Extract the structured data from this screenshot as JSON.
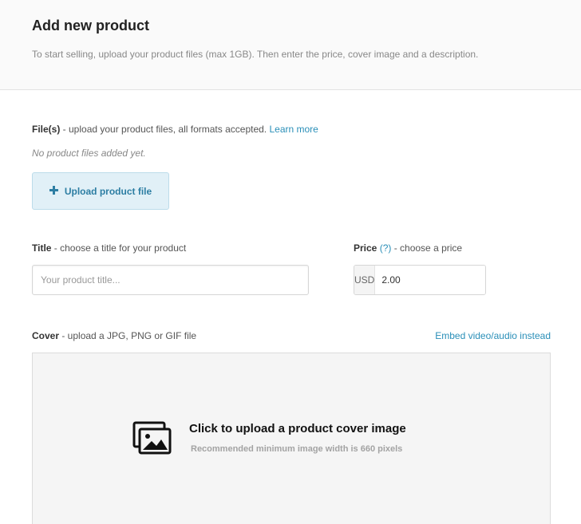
{
  "header": {
    "title": "Add new product",
    "subtitle": "To start selling, upload your product files (max 1GB). Then enter the price, cover image and a description."
  },
  "files": {
    "label_bold": "File(s)",
    "label_rest": " - upload your product files, all formats accepted. ",
    "learn_more": "Learn more",
    "empty_text": "No product files added yet.",
    "upload_icon": "plus-icon",
    "upload_label": "Upload product file"
  },
  "title_field": {
    "label_bold": "Title",
    "label_rest": " - choose a title for your product",
    "value": "",
    "placeholder": "Your product title..."
  },
  "price_field": {
    "label_bold": "Price",
    "help_link": "(?)",
    "label_rest": " - choose a price",
    "currency": "USD",
    "value": "2.00"
  },
  "cover": {
    "label_bold": "Cover",
    "label_rest": " - upload a JPG, PNG or GIF file",
    "embed_link": "Embed video/audio instead",
    "icon": "image-stack-icon",
    "main_text": "Click to upload a product cover image",
    "sub_text": "Recommended minimum image width is 660 pixels"
  },
  "colors": {
    "link": "#2a8fb8",
    "upload_button_bg": "#e1f0f7",
    "upload_button_text": "#2d7ea3",
    "dropzone_bg": "#f5f5f5"
  }
}
